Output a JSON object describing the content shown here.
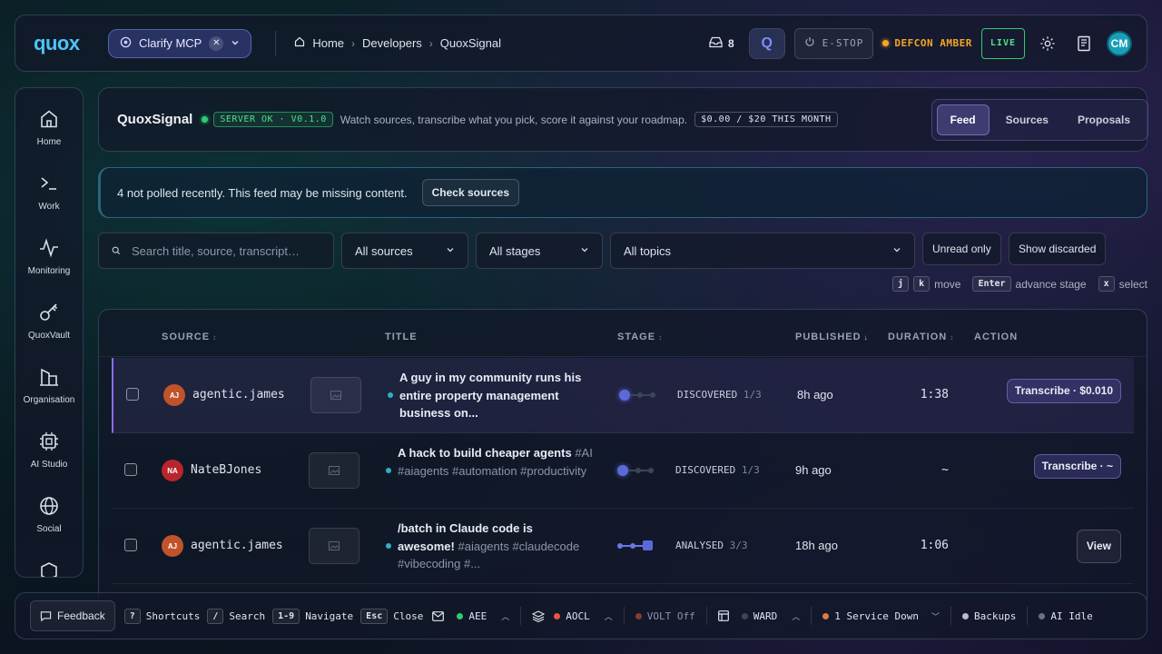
{
  "topbar": {
    "logo": "quox",
    "mcp_label": "Clarify MCP",
    "breadcrumbs": [
      "Home",
      "Developers",
      "QuoxSignal"
    ],
    "inbox_count": "8",
    "q_label": "Q",
    "estop_label": "E-STOP",
    "defcon_label": "DEFCON AMBER",
    "live_label": "LIVE",
    "avatar_initials": "CM"
  },
  "sidebar": {
    "items": [
      {
        "label": "Home",
        "icon": "home-icon"
      },
      {
        "label": "Work",
        "icon": "terminal-icon"
      },
      {
        "label": "Monitoring",
        "icon": "pulse-icon"
      },
      {
        "label": "QuoxVault",
        "icon": "key-icon"
      },
      {
        "label": "Organisation",
        "icon": "building-icon"
      },
      {
        "label": "AI Studio",
        "icon": "chip-icon"
      },
      {
        "label": "Social",
        "icon": "globe-icon"
      }
    ]
  },
  "header": {
    "title": "QuoxSignal",
    "server_status": "SERVER OK · V0.1.0",
    "description": "Watch sources, transcribe what you pick, score it against your roadmap.",
    "budget": "$0.00 / $20 THIS MONTH",
    "tabs": [
      "Feed",
      "Sources",
      "Proposals"
    ],
    "active_tab": "Feed"
  },
  "alert": {
    "message": "4 not polled recently. This feed may be missing content.",
    "button": "Check sources"
  },
  "filters": {
    "search_placeholder": "Search title, source, transcript…",
    "sources": "All sources",
    "stages": "All stages",
    "topics": "All topics",
    "unread_only": "Unread only",
    "show_discarded": "Show discarded"
  },
  "hints": {
    "k1": "j",
    "k2": "k",
    "move": "move",
    "k3": "Enter",
    "advance": "advance stage",
    "k4": "x",
    "select": "select"
  },
  "table": {
    "columns": {
      "source": "SOURCE",
      "title": "TITLE",
      "stage": "STAGE",
      "published": "PUBLISHED",
      "duration": "DURATION",
      "action": "ACTION"
    },
    "rows": [
      {
        "initials": "AJ",
        "source": "agentic.james",
        "title": "A guy in my community runs his entire property management business on...",
        "tags": "",
        "stage": "DISCOVERED",
        "stage_frac": "1/3",
        "published": "8h ago",
        "duration": "1:38",
        "action": "Transcribe · $0.010"
      },
      {
        "initials": "NA",
        "source": "NateBJones",
        "title": "A hack to build cheaper agents",
        "tags": "#AI #aiagents #automation #productivity",
        "stage": "DISCOVERED",
        "stage_frac": "1/3",
        "published": "9h ago",
        "duration": "~",
        "action": "Transcribe · ~"
      },
      {
        "initials": "AJ",
        "source": "agentic.james",
        "title": "/batch in Claude code is awesome!",
        "tags": "#aiagents #claudecode #vibecoding #...",
        "stage": "ANALYSED",
        "stage_frac": "3/3",
        "published": "18h ago",
        "duration": "1:06",
        "action": "View"
      }
    ]
  },
  "bottombar": {
    "feedback": "Feedback",
    "shortcuts_key": "?",
    "shortcuts": "Shortcuts",
    "search_key": "/",
    "search": "Search",
    "navigate_key": "1-9",
    "navigate": "Navigate",
    "close_key": "Esc",
    "close": "Close",
    "aee": "AEE",
    "aocl": "AOCL",
    "volt": "VOLT Off",
    "ward": "WARD",
    "service": "1 Service Down",
    "backups": "Backups",
    "ai": "AI Idle"
  },
  "colors": {
    "accent": "#4fc3f7",
    "ok_green": "#2ecc71",
    "amber": "#f5a623",
    "purple": "#8a6cff"
  }
}
